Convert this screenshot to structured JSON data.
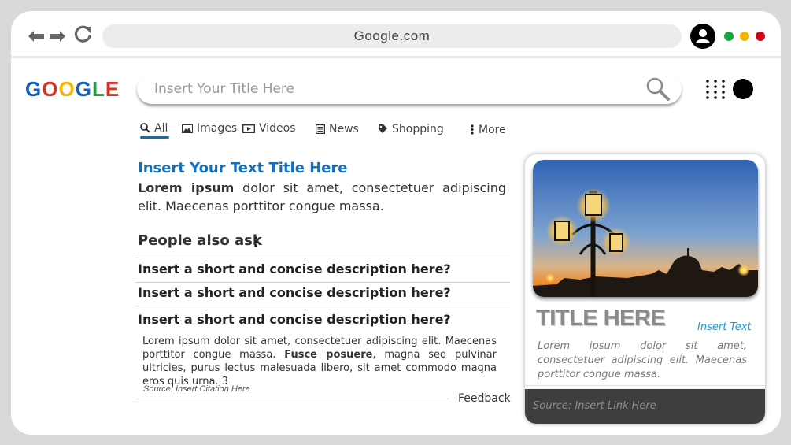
{
  "browser": {
    "address": "Google.com",
    "window_dots": [
      {
        "name": "green",
        "color": "#1aa34a"
      },
      {
        "name": "yellow",
        "color": "#f5b400"
      },
      {
        "name": "red",
        "color": "#d0021b"
      }
    ]
  },
  "logo": {
    "letters": [
      {
        "char": "G",
        "color": "#1560bd"
      },
      {
        "char": "O",
        "color": "#d93025"
      },
      {
        "char": "O",
        "color": "#f4b400"
      },
      {
        "char": "G",
        "color": "#1560bd"
      },
      {
        "char": "L",
        "color": "#1e9e3e"
      },
      {
        "char": "E",
        "color": "#d93025"
      }
    ]
  },
  "search": {
    "placeholder": "Insert Your Title Here"
  },
  "tabs": [
    {
      "label": "All",
      "icon": "search-icon",
      "active": true
    },
    {
      "label": "Images",
      "icon": "image-icon",
      "active": false
    },
    {
      "label": "Videos",
      "icon": "video-icon",
      "active": false
    },
    {
      "label": "News",
      "icon": "news-icon",
      "active": false
    },
    {
      "label": "Shopping",
      "icon": "tag-icon",
      "active": false
    },
    {
      "label": "More",
      "icon": "more-vertical-icon",
      "active": false
    }
  ],
  "result": {
    "title": "Insert Your Text Title Here",
    "snippet_bold": "Lorem ipsum",
    "snippet_rest": " dolor sit amet, consectetuer adipiscing elit. Maecenas porttitor congue massa."
  },
  "people_also_ask": {
    "heading": "People also ask",
    "questions": [
      "Insert a short and concise description here?",
      "Insert a short and concise description here?",
      "Insert a short and concise description here?"
    ],
    "answer_part1": "Lorem ipsum dolor sit amet, consectetuer adipiscing elit. Maecenas porttitor congue massa. ",
    "answer_bold": "Fusce posuere",
    "answer_part2": ", magna sed pulvinar ultricies, purus lectus malesuada libero, sit amet commodo magna eros quis urna. 3",
    "citation": "Source: Insert Citation Here",
    "feedback": "Feedback"
  },
  "knowledge_card": {
    "title": "TITLE HERE",
    "insert_text": "Insert Text",
    "description": "Lorem ipsum dolor sit amet, consectetuer adipiscing elit. Maecenas porttitor congue massa.",
    "source": "Source: Insert Link Here"
  },
  "colors": {
    "link_blue": "#1170c0",
    "accent_blue": "#1c9ad6",
    "source_bar": "#3f3e3c"
  }
}
